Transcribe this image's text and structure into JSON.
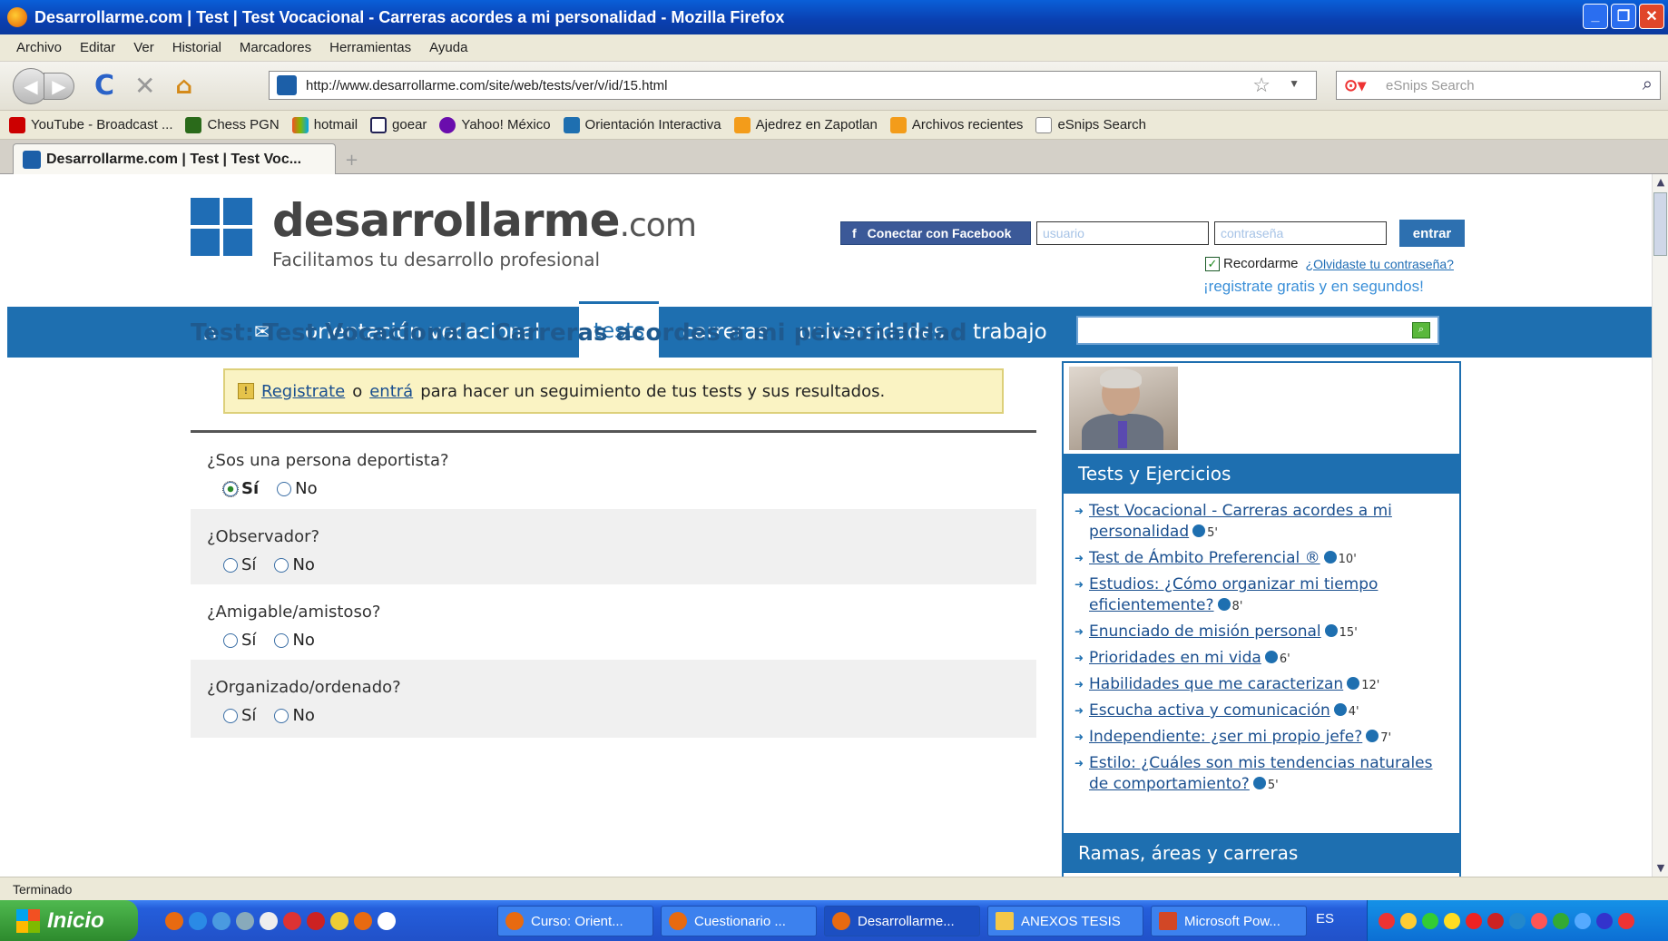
{
  "window": {
    "title": "Desarrollarme.com | Test | Test Vocacional - Carreras acordes a mi personalidad - Mozilla Firefox"
  },
  "menu": [
    "Archivo",
    "Editar",
    "Ver",
    "Historial",
    "Marcadores",
    "Herramientas",
    "Ayuda"
  ],
  "nav": {
    "url": "http://www.desarrollarme.com/site/web/tests/ver/v/id/15.html",
    "search_placeholder": "eSnips Search"
  },
  "bookmarks": [
    "YouTube - Broadcast ...",
    "Chess PGN",
    "hotmail",
    "goear",
    "Yahoo! México",
    "Orientación Interactiva",
    "Ajedrez en Zapotlan",
    "Archivos recientes",
    "eSnips Search"
  ],
  "tab": {
    "label": "Desarrollarme.com | Test | Test Voc..."
  },
  "site": {
    "logo": "desarrollarme",
    "logo_suffix": ".com",
    "tagline": "Facilitamos tu desarrollo profesional",
    "fb_button": "Conectar con Facebook",
    "user_placeholder": "usuario",
    "pass_placeholder": "contraseña",
    "login_button": "entrar",
    "remember": "Recordarme",
    "forgot": "¿Olvidaste tu contraseña?",
    "register": "¡registrate gratis y en segundos!"
  },
  "mainnav": [
    "orientación vocacional",
    "tests",
    "carreras",
    "universidades",
    "trabajo"
  ],
  "page": {
    "title": "Test: Test Vocacional - Carreras acordes a mi personalidad",
    "notice_link1": "Registrate",
    "notice_o": "o",
    "notice_link2": "entrá",
    "notice_rest": "para hacer un seguimiento de tus tests y sus resultados."
  },
  "questions": [
    {
      "text": "¿Sos una persona deportista?",
      "yes": "Sí",
      "no": "No",
      "selected": "yes"
    },
    {
      "text": "¿Observador?",
      "yes": "Sí",
      "no": "No",
      "selected": null
    },
    {
      "text": "¿Amigable/amistoso?",
      "yes": "Sí",
      "no": "No",
      "selected": null
    },
    {
      "text": "¿Organizado/ordenado?",
      "yes": "Sí",
      "no": "No",
      "selected": null
    }
  ],
  "sidebar": {
    "tests_heading": "Tests y Ejercicios",
    "items": [
      {
        "label": "Test Vocacional - Carreras acordes a mi personalidad",
        "time": "5'"
      },
      {
        "label": "Test de Ámbito Preferencial ®",
        "time": "10'"
      },
      {
        "label": "Estudios: ¿Cómo organizar mi tiempo eficientemente?",
        "time": "8'"
      },
      {
        "label": "Enunciado de misión personal",
        "time": "15'"
      },
      {
        "label": "Prioridades en mi vida",
        "time": "6'"
      },
      {
        "label": "Habilidades que me caracterizan",
        "time": "12'"
      },
      {
        "label": "Escucha activa y comunicación",
        "time": "4'"
      },
      {
        "label": "Independiente: ¿ser mi propio jefe?",
        "time": "7'"
      },
      {
        "label": "Estilo: ¿Cuáles son mis tendencias naturales de comportamiento?",
        "time": "5'"
      }
    ],
    "careers_heading": "Ramas, áreas y carreras"
  },
  "status": "Terminado",
  "taskbar": {
    "start": "Inicio",
    "tasks": [
      "Curso: Orient...",
      "Cuestionario ...",
      "Desarrollarme...",
      "ANEXOS TESIS",
      "Microsoft Pow..."
    ],
    "lang": "ES"
  }
}
